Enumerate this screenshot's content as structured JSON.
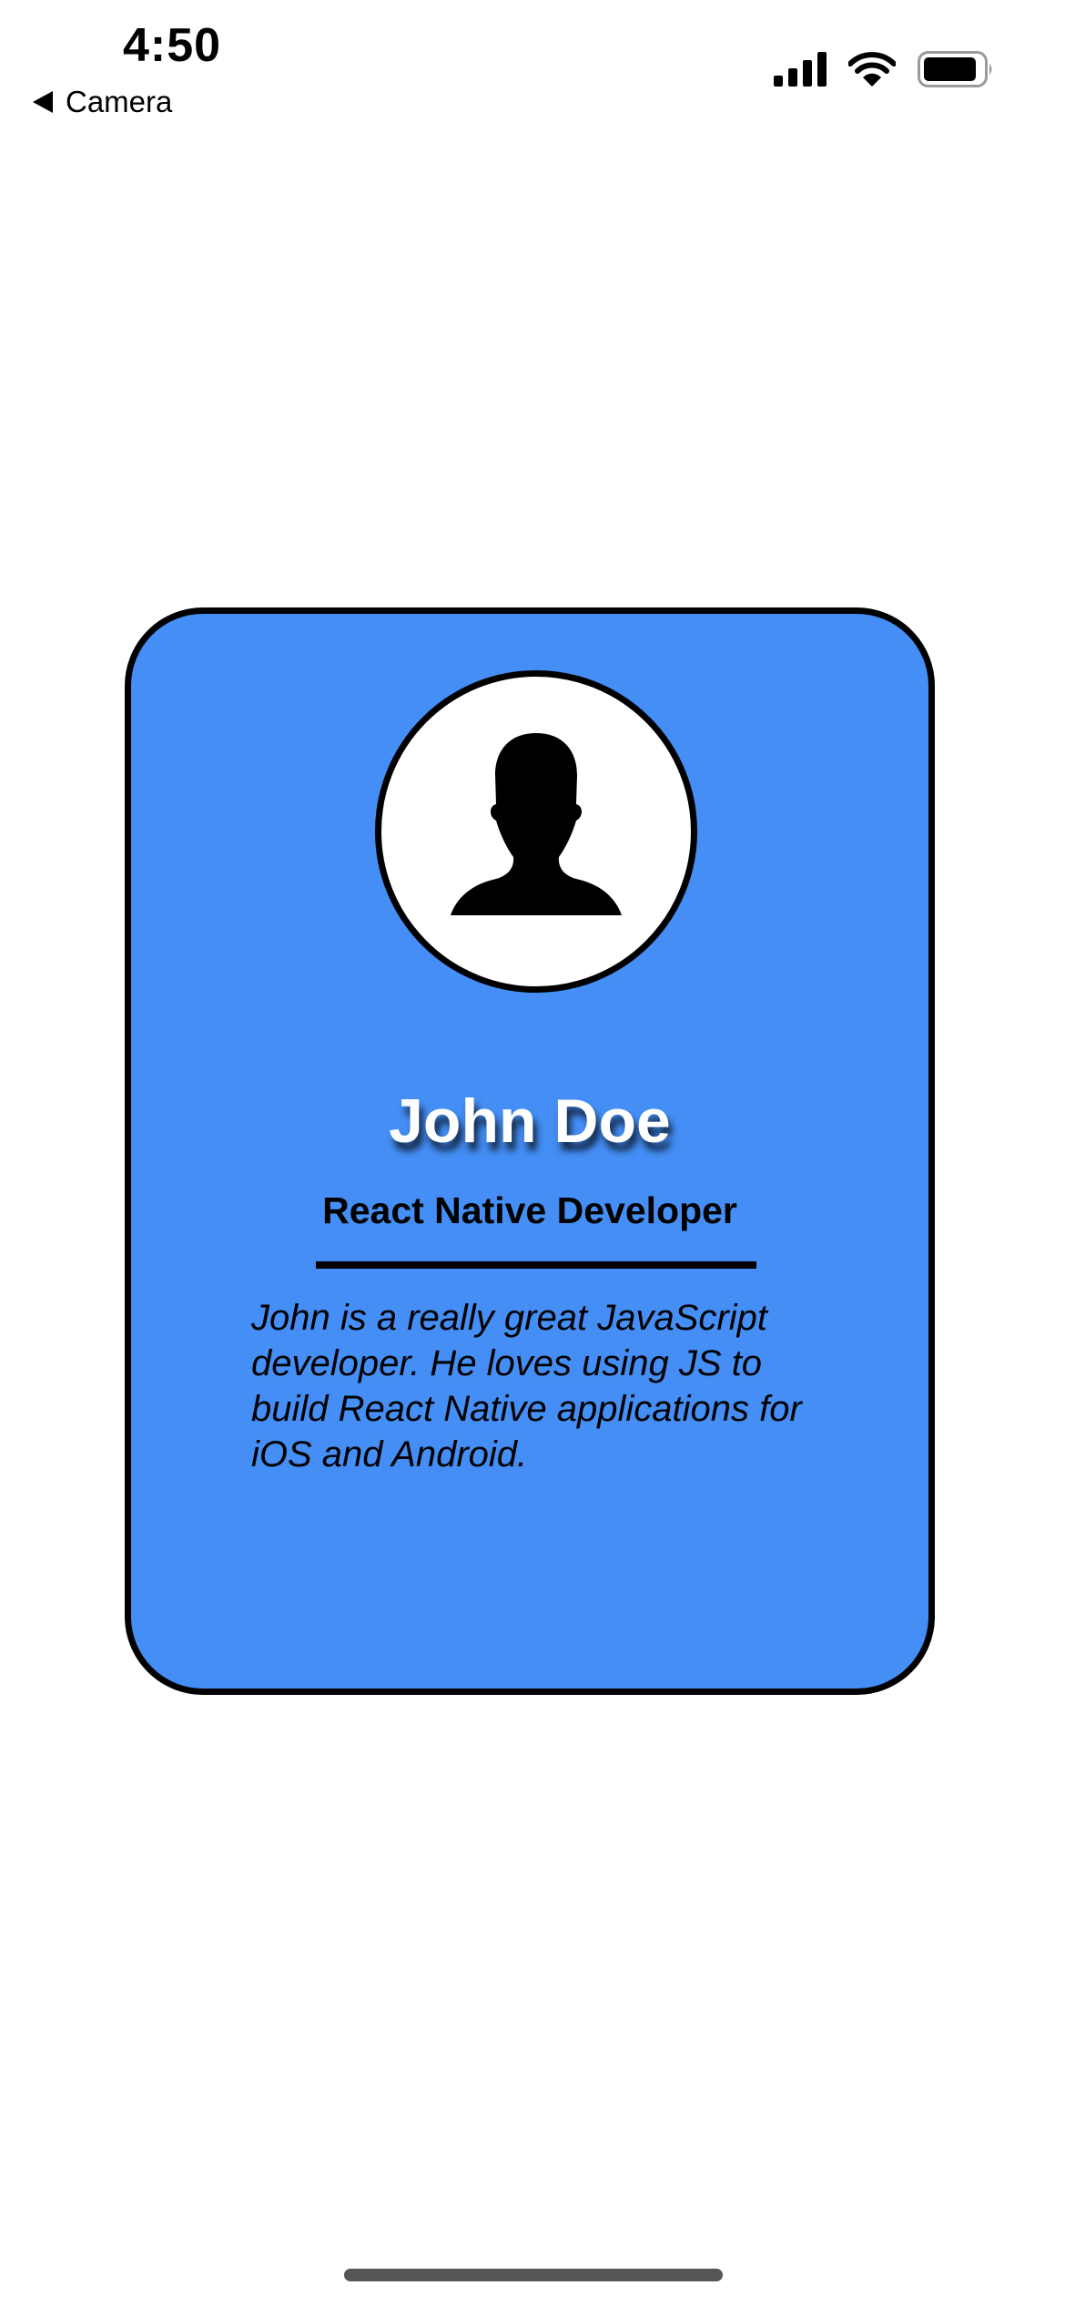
{
  "status_bar": {
    "time": "4:50",
    "back_label": "Camera",
    "icons": [
      "cellular-signal-icon",
      "wifi-icon",
      "battery-icon"
    ]
  },
  "card": {
    "background_color": "#448ef6",
    "avatar_icon": "user-silhouette-icon",
    "name": "John Doe",
    "role": "React Native Developer",
    "bio": "John is a really great JavaScript developer. He loves using JS to build React Native applications for iOS and Android."
  }
}
